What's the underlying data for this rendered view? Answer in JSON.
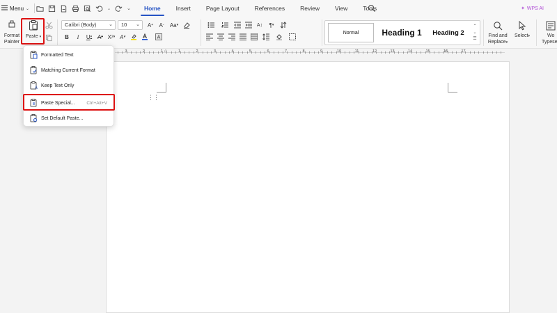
{
  "topbar": {
    "menu_label": "Menu",
    "tabs": [
      "Home",
      "Insert",
      "Page Layout",
      "References",
      "Review",
      "View",
      "Tools"
    ],
    "active_tab": "Home",
    "ai_label": "WPS AI"
  },
  "ribbon": {
    "format_painter_line1": "Format",
    "format_painter_line2": "Painter",
    "paste_label": "Paste",
    "font_name": "Calibri (Body)",
    "font_size": "10",
    "styles": [
      "Normal",
      "Heading 1",
      "Heading 2"
    ],
    "find_replace_line1": "Find and",
    "find_replace_line2": "Replace",
    "select_label": "Select",
    "word_typeset_line1": "Wo",
    "word_typeset_line2": "Typese"
  },
  "paste_menu": {
    "items": [
      {
        "label": "Formatted Text",
        "shortcut": ""
      },
      {
        "label": "Matching Current Format",
        "shortcut": ""
      },
      {
        "label": "Keep Text Only",
        "shortcut": ""
      },
      {
        "label": "Paste Special...",
        "shortcut": "Ctrl+Alt+V"
      },
      {
        "label": "Set Default Paste...",
        "shortcut": ""
      }
    ]
  },
  "ruler": {
    "numbers": [
      "3",
      "2",
      "1",
      "1",
      "2",
      "3",
      "4",
      "5",
      "6",
      "7",
      "8",
      "9",
      "10",
      "11",
      "12",
      "13",
      "14",
      "15",
      "16",
      "17"
    ]
  },
  "colors": {
    "accent": "#2553c4",
    "highlight": "#dd1111",
    "ai": "#b04fd6"
  }
}
